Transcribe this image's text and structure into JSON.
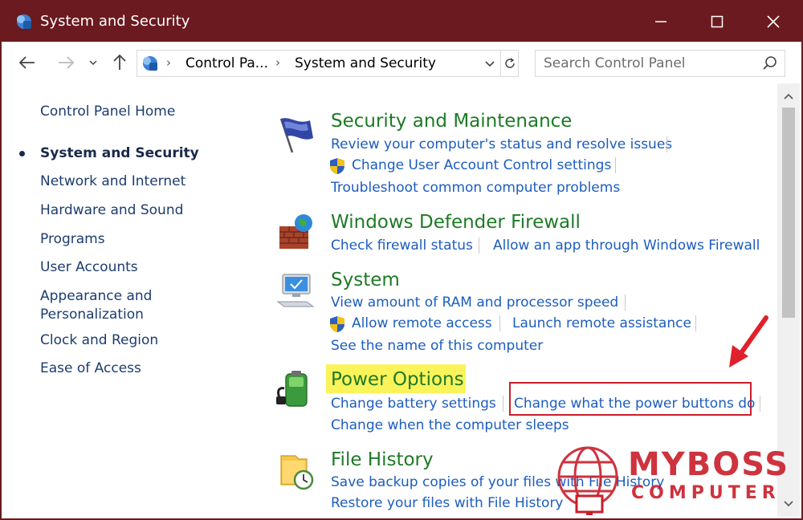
{
  "window": {
    "title": "System and Security",
    "controls": {
      "minimize_icon": "minimize-icon",
      "maximize_icon": "maximize-icon",
      "close_icon": "close-icon"
    }
  },
  "address_bar": {
    "breadcrumb": [
      "Control Pa...",
      "System and Security"
    ],
    "icons": [
      "back-arrow-icon",
      "forward-arrow-icon",
      "recent-dropdown-icon",
      "up-arrow-icon",
      "control-panel-icon",
      "dropdown-icon",
      "refresh-icon"
    ]
  },
  "search": {
    "placeholder": "Search Control Panel",
    "value": ""
  },
  "left_nav": {
    "items": [
      {
        "label": "Control Panel Home",
        "active": false
      },
      {
        "label": "System and Security",
        "active": true
      },
      {
        "label": "Network and Internet",
        "active": false
      },
      {
        "label": "Hardware and Sound",
        "active": false
      },
      {
        "label": "Programs",
        "active": false
      },
      {
        "label": "User Accounts",
        "active": false
      },
      {
        "label": "Appearance and",
        "label2": "Personalization",
        "active": false
      },
      {
        "label": "Clock and Region",
        "active": false
      },
      {
        "label": "Ease of Access",
        "active": false
      }
    ]
  },
  "categories": {
    "security": {
      "title": "Security and Maintenance",
      "links": [
        "Review your computer's status and resolve issues",
        "Change User Account Control settings",
        "Troubleshoot common computer problems"
      ]
    },
    "firewall": {
      "title": "Windows Defender Firewall",
      "links": [
        "Check firewall status",
        "Allow an app through Windows Firewall"
      ]
    },
    "system": {
      "title": "System",
      "links": [
        "View amount of RAM and processor speed",
        "Allow remote access",
        "Launch remote assistance",
        "See the name of this computer"
      ]
    },
    "power": {
      "title": "Power Options",
      "links": [
        "Change battery settings",
        "Change what the power buttons do",
        "Change when the computer sleeps"
      ]
    },
    "filehistory": {
      "title": "File History",
      "links": [
        "Save backup copies of your files with File History",
        "Restore your files with File History"
      ]
    }
  },
  "colors": {
    "titlebar": "#6b1a1f",
    "category_title": "#1e7a26",
    "link": "#1c5dbf",
    "highlight": "#fbf35a",
    "annotation_red": "#c91e2a"
  },
  "watermark": {
    "line1": "MYBOSS",
    "line2": "COMPUTER"
  }
}
